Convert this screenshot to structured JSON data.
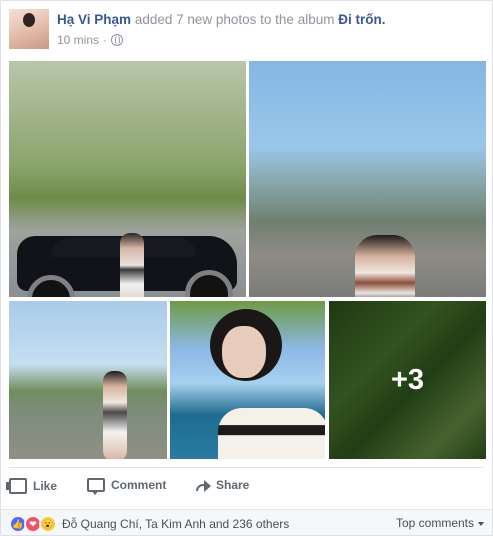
{
  "post": {
    "author": "Hạ Vi Phạm",
    "action": "added 7 new photos to the album",
    "album": "Đi trốn.",
    "time": "10 mins"
  },
  "photos": {
    "extra_count": "+3"
  },
  "actions": {
    "like": "Like",
    "comment": "Comment",
    "share": "Share"
  },
  "reactions": {
    "summary": "Đỗ Quang Chí, Ta Kim Anh and 236 others",
    "top_comments": "Top comments"
  },
  "icons": {
    "privacy": "globe-icon",
    "like": "thumbs-up-icon",
    "comment": "comment-icon",
    "share": "share-icon",
    "reaction_like": "like-reaction-icon",
    "reaction_love": "love-reaction-icon",
    "reaction_wow": "wow-reaction-icon"
  }
}
